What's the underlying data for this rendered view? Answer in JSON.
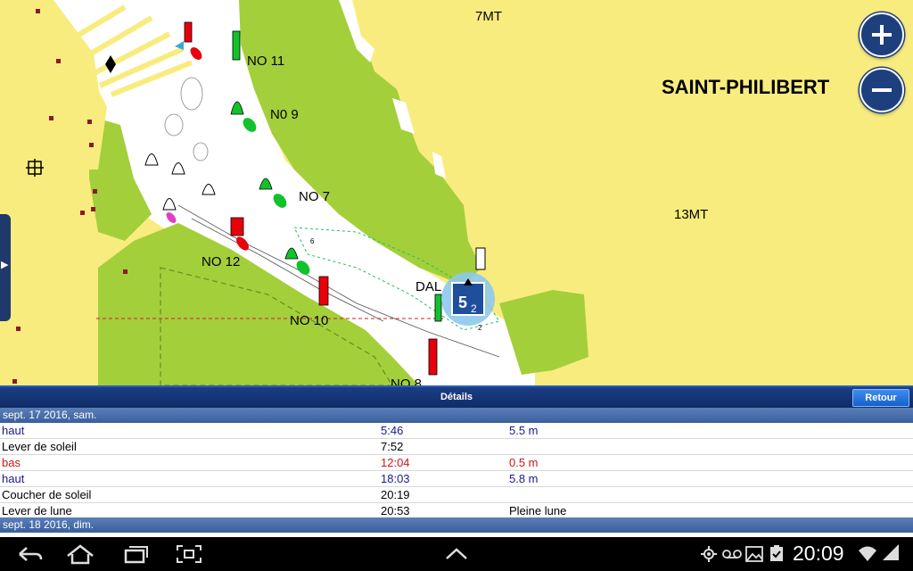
{
  "map": {
    "place_name": "SAINT-PHILIBERT",
    "labels": [
      "7MT",
      "13MT",
      "NO 11",
      "N0 9",
      "NO 7",
      "NO 12",
      "NO 10",
      "DAL",
      "NO 8"
    ],
    "tide_icon": {
      "big": "5",
      "small": "2"
    },
    "colors": {
      "land": "#f9ec7e",
      "shallow": "#a3cf3b",
      "water": "#ffffff",
      "red_marker": "#e8000b",
      "green_marker": "#12c22c"
    }
  },
  "zoom": {
    "in_icon": "plus-icon",
    "out_icon": "minus-icon"
  },
  "details": {
    "title": "Détails",
    "back_label": "Retour",
    "days": [
      {
        "header": "sept. 17 2016, sam."
      },
      {
        "header": "sept. 18 2016, dim."
      }
    ],
    "rows": [
      {
        "event": "haut",
        "time": "5:46",
        "value": "5.5 m",
        "kind": "high"
      },
      {
        "event": "Lever de soleil",
        "time": "7:52",
        "value": "",
        "kind": "sun"
      },
      {
        "event": "bas",
        "time": "12:04",
        "value": "0.5 m",
        "kind": "low"
      },
      {
        "event": "haut",
        "time": "18:03",
        "value": "5.8 m",
        "kind": "high"
      },
      {
        "event": "Coucher de soleil",
        "time": "20:19",
        "value": "",
        "kind": "sun"
      },
      {
        "event": "Lever de lune",
        "time": "20:53",
        "value": "Pleine lune",
        "kind": "moon"
      }
    ],
    "colors": {
      "high": "#1a1a8a",
      "low": "#c81818",
      "sun": "#000000",
      "moon": "#000000"
    }
  },
  "statusbar": {
    "clock": "20:09",
    "icons": [
      "back-icon",
      "home-icon",
      "recent-apps-icon",
      "screenshot-icon",
      "up-chevron-icon",
      "gps-icon",
      "voicemail-icon",
      "gallery-icon",
      "clipboard-icon",
      "wifi-icon",
      "signal-icon"
    ]
  }
}
